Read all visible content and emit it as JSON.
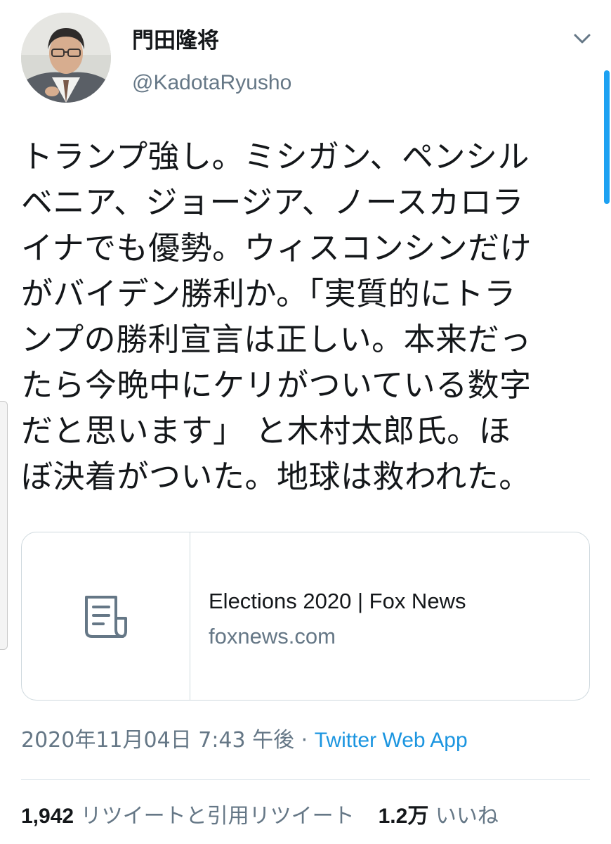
{
  "user": {
    "display_name": "門田隆将",
    "handle": "@KadotaRyusho"
  },
  "tweet": {
    "text": "トランプ強し。ミシガン、ペンシル\nベニア、ジョージア、ノースカロラ\nイナでも優勢。ウィスコンシンだけ\nがバイデン勝利か。「実質的にトラ\nンプの勝利宣言は正しい。本来だっ\nたら今晩中にケリがついている数字\nだと思います」 と木村太郎氏。ほ\nぼ決着がついた。地球は救われた。"
  },
  "card": {
    "icon": "document-icon",
    "title": "Elections 2020 | Fox News",
    "domain": "foxnews.com"
  },
  "meta": {
    "timestamp": "2020年11月04日 7:43 午後",
    "separator": " · ",
    "source": "Twitter Web App"
  },
  "stats": {
    "retweets_count": "1,942",
    "retweets_label": "リツイートと引用リツイート",
    "likes_count": "1.2万",
    "likes_label": "いいね"
  },
  "colors": {
    "link": "#1b95e0",
    "secondary_text": "#657786",
    "border": "#cfd9de",
    "scrollbar": "#1da1f2"
  }
}
